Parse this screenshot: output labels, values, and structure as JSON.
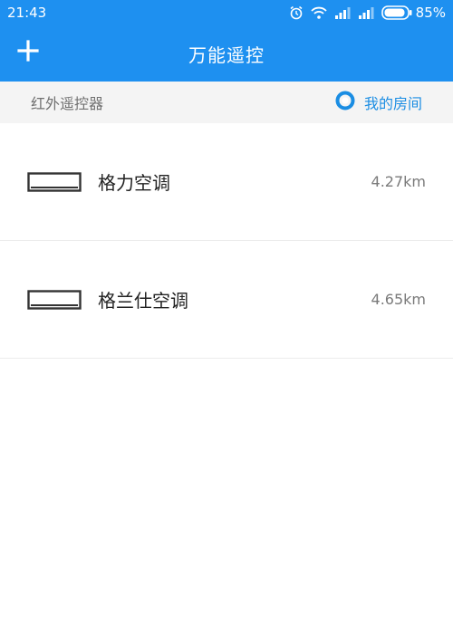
{
  "status_bar": {
    "time": "21:43",
    "battery": "85%",
    "icons": [
      "alarm-icon",
      "wifi-icon",
      "signal-icon",
      "signal-icon",
      "battery-icon"
    ]
  },
  "appbar": {
    "title": "万能遥控",
    "add_icon": "plus-icon"
  },
  "subheader": {
    "label": "红外遥控器",
    "room_label": "我的房间",
    "room_icon": "location-ring-icon"
  },
  "devices": [
    {
      "name": "格力空调",
      "distance": "4.27km",
      "icon": "air-conditioner-icon"
    },
    {
      "name": "格兰仕空调",
      "distance": "4.65km",
      "icon": "air-conditioner-icon"
    }
  ],
  "colors": {
    "header_bg": "#1e90f0",
    "accent": "#1a8de3",
    "subheader_bg": "#f4f4f4"
  }
}
